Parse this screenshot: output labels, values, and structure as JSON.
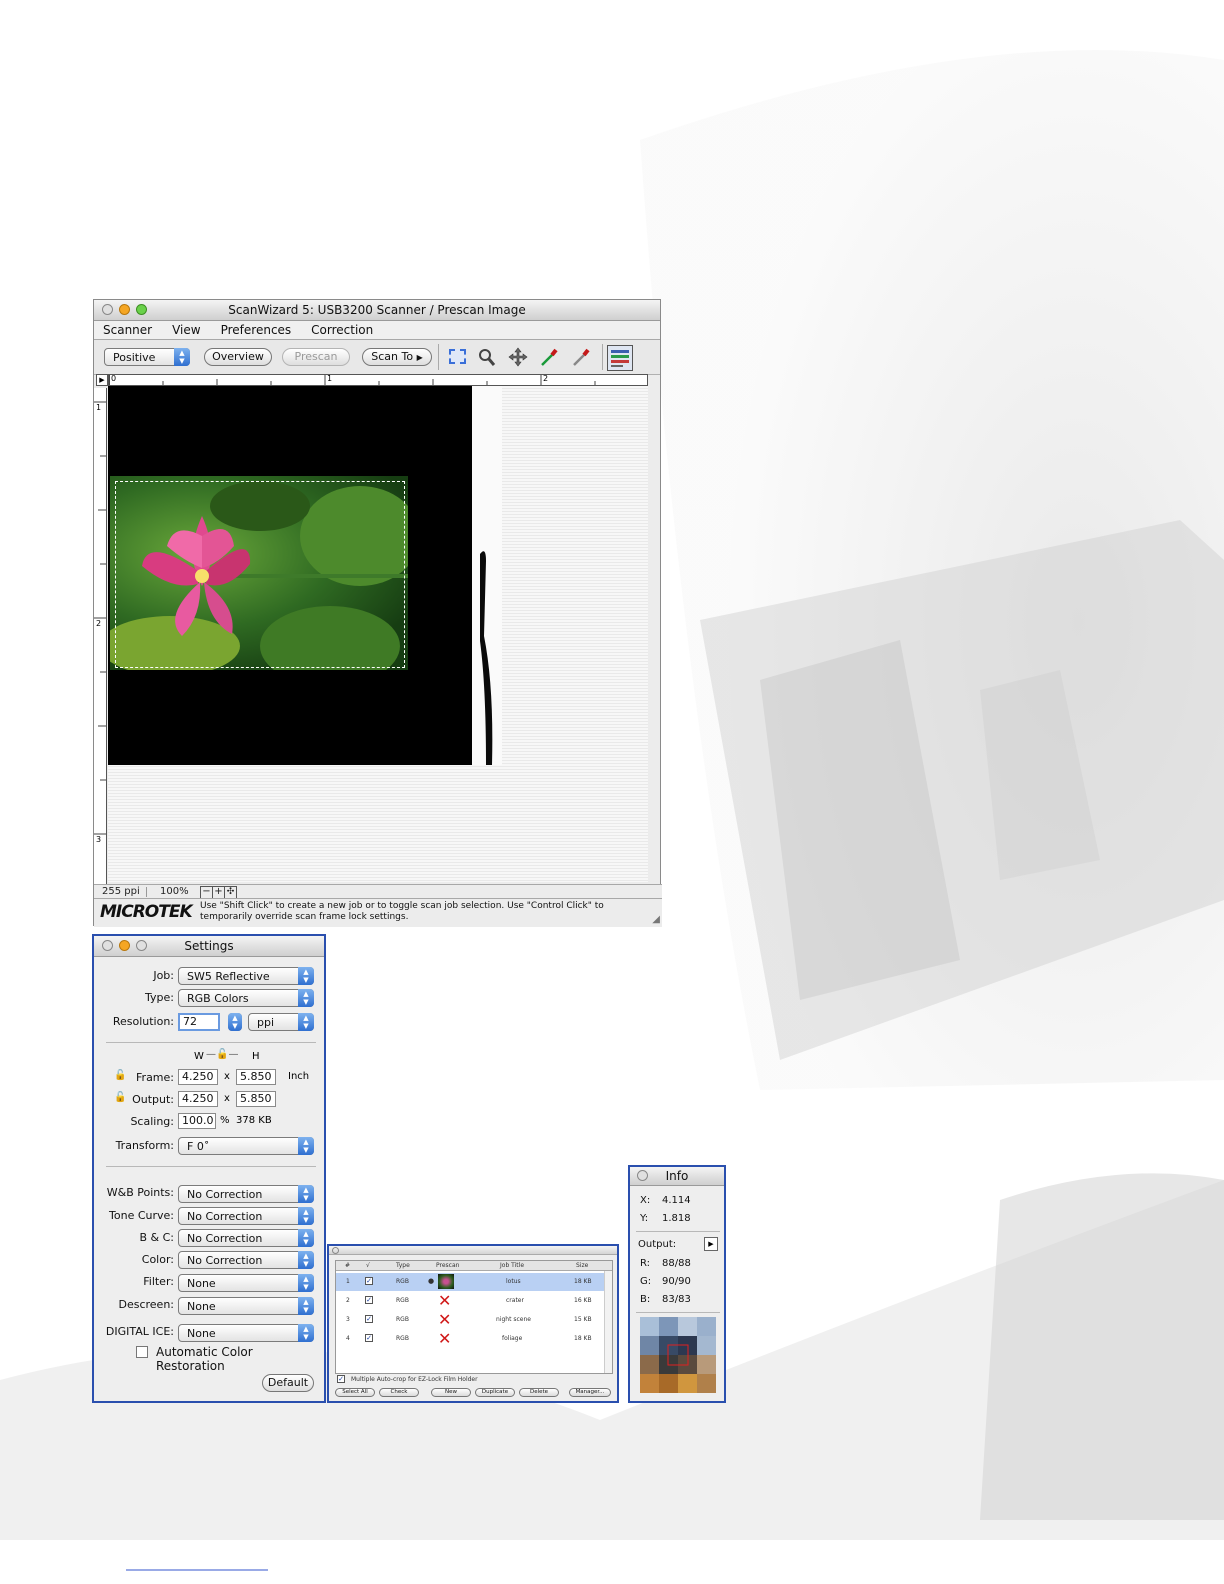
{
  "scanner_window": {
    "title": "ScanWizard 5: USB3200 Scanner / Prescan Image",
    "menu": [
      "Scanner",
      "View",
      "Preferences",
      "Correction"
    ],
    "mode_value": "Positive",
    "buttons": {
      "overview": "Overview",
      "prescan": "Prescan",
      "scan_to": "Scan To"
    },
    "tool_icons": [
      "marquee-icon",
      "magnifier-icon",
      "move-icon",
      "eyedropper-icon",
      "eyedropper-icon",
      "settings-panel-icon"
    ],
    "ruler_h_labels": [
      "0",
      "1",
      "2"
    ],
    "ruler_v_labels": [
      "1",
      "2",
      "3"
    ],
    "status": {
      "resolution": "255 ppi",
      "zoom": "100%"
    },
    "brand": "MICROTEK",
    "hint": "Use \"Shift Click\" to create a new job or to toggle scan job selection. Use \"Control Click\" to temporarily override scan frame lock settings."
  },
  "settings_window": {
    "title": "Settings",
    "job_label": "Job:",
    "job_value": "SW5 Reflective",
    "type_label": "Type:",
    "type_value": "RGB Colors",
    "resolution_label": "Resolution:",
    "resolution_value": "72",
    "resolution_unit": "ppi",
    "w_label": "W",
    "h_label": "H",
    "frame_label": "Frame:",
    "frame_w": "4.250",
    "frame_h": "5.850",
    "frame_unit": "Inch",
    "output_label": "Output:",
    "output_w": "4.250",
    "output_h": "5.850",
    "times": "x",
    "scaling_label": "Scaling:",
    "scaling_value": "100.0",
    "scaling_unit": "%",
    "file_size": "378 KB",
    "transform_label": "Transform:",
    "transform_value": "F 0˚",
    "wb_label": "W&B Points:",
    "wb_value": "No Correction",
    "tone_label": "Tone Curve:",
    "tone_value": "No Correction",
    "bc_label": "B & C:",
    "bc_value": "No Correction",
    "color_label": "Color:",
    "color_value": "No Correction",
    "filter_label": "Filter:",
    "filter_value": "None",
    "descreen_label": "Descreen:",
    "descreen_value": "None",
    "ice_label": "DIGITAL ICE:",
    "ice_value": "None",
    "acr_label": "Automatic Color Restoration",
    "default_button": "Default"
  },
  "jobs_window": {
    "columns": [
      "#",
      "√",
      "Type",
      "Prescan",
      "Job Title",
      "Size"
    ],
    "rows": [
      {
        "num": "1",
        "type": "RGB",
        "title": "lotus",
        "size": "18 KB",
        "selected": true
      },
      {
        "num": "2",
        "type": "RGB",
        "title": "crater",
        "size": "16 KB",
        "selected": false
      },
      {
        "num": "3",
        "type": "RGB",
        "title": "night scene",
        "size": "15 KB",
        "selected": false
      },
      {
        "num": "4",
        "type": "RGB",
        "title": "foliage",
        "size": "18 KB",
        "selected": false
      }
    ],
    "multi_label": "Multiple Auto-crop for EZ-Lock Film Holder",
    "buttons": [
      "Select All",
      "Check",
      "New",
      "Duplicate",
      "Delete",
      "Manager..."
    ]
  },
  "info_window": {
    "title": "Info",
    "x_label": "X:",
    "x_value": "4.114",
    "y_label": "Y:",
    "y_value": "1.818",
    "output_label": "Output:",
    "r_label": "R:",
    "r_value": "88/88",
    "g_label": "G:",
    "g_value": "90/90",
    "b_label": "B:",
    "b_value": "83/83"
  }
}
